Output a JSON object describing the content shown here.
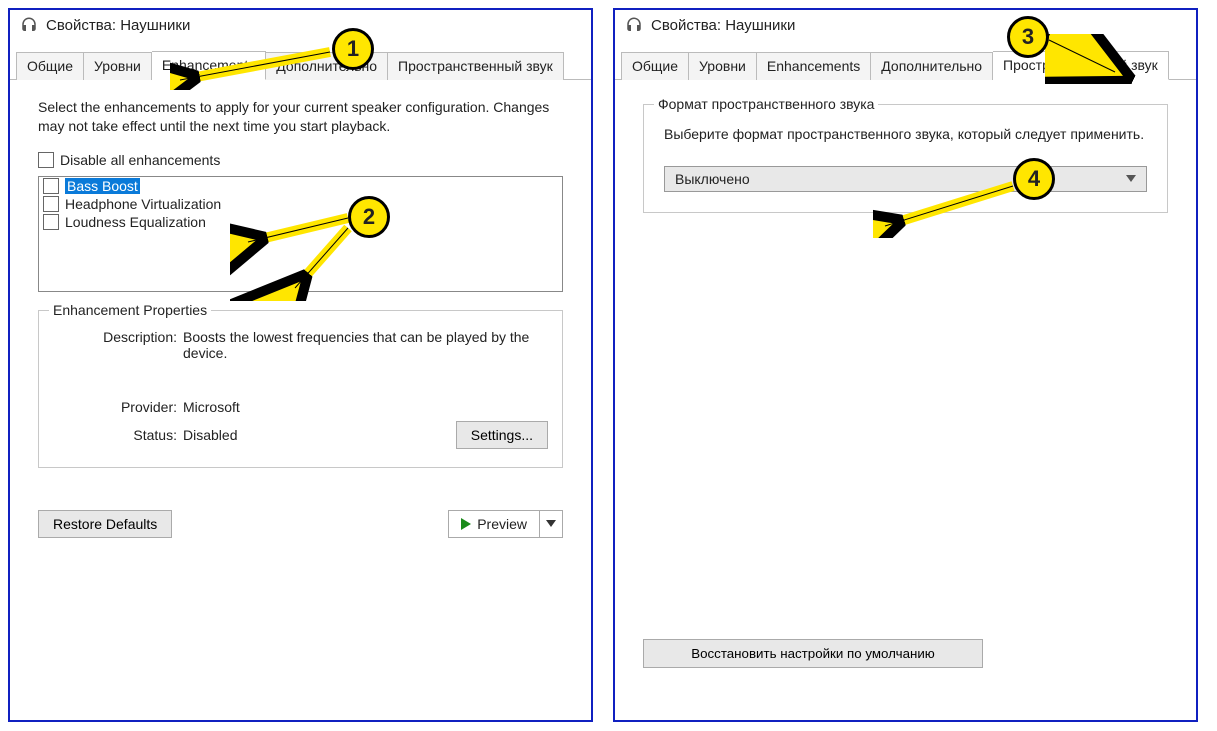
{
  "markers": {
    "m1": "1",
    "m2": "2",
    "m3": "3",
    "m4": "4"
  },
  "left": {
    "title": "Свойства: Наушники",
    "tabs": {
      "general": "Общие",
      "levels": "Уровни",
      "enhancements": "Enhancements",
      "advanced": "Дополнительно",
      "spatial": "Пространственный звук"
    },
    "instructions": "Select the enhancements to apply for your current speaker configuration. Changes may not take effect until the next time you start playback.",
    "disable_all": "Disable all enhancements",
    "enhancements": [
      "Bass Boost",
      "Headphone Virtualization",
      "Loudness Equalization"
    ],
    "group_title": "Enhancement Properties",
    "desc_label": "Description:",
    "desc_value": "Boosts the lowest frequencies that can be played by the device.",
    "provider_label": "Provider:",
    "provider_value": "Microsoft",
    "status_label": "Status:",
    "status_value": "Disabled",
    "settings_btn": "Settings...",
    "restore_btn": "Restore Defaults",
    "preview_btn": "Preview"
  },
  "right": {
    "title": "Свойства: Наушники",
    "tabs": {
      "general": "Общие",
      "levels": "Уровни",
      "enhancements": "Enhancements",
      "advanced": "Дополнительно",
      "spatial": "Пространственный звук"
    },
    "group_title": "Формат пространственного звука",
    "group_instr": "Выберите формат пространственного звука, который следует применить.",
    "combo_value": "Выключено",
    "restore_btn": "Восстановить настройки по умолчанию"
  }
}
